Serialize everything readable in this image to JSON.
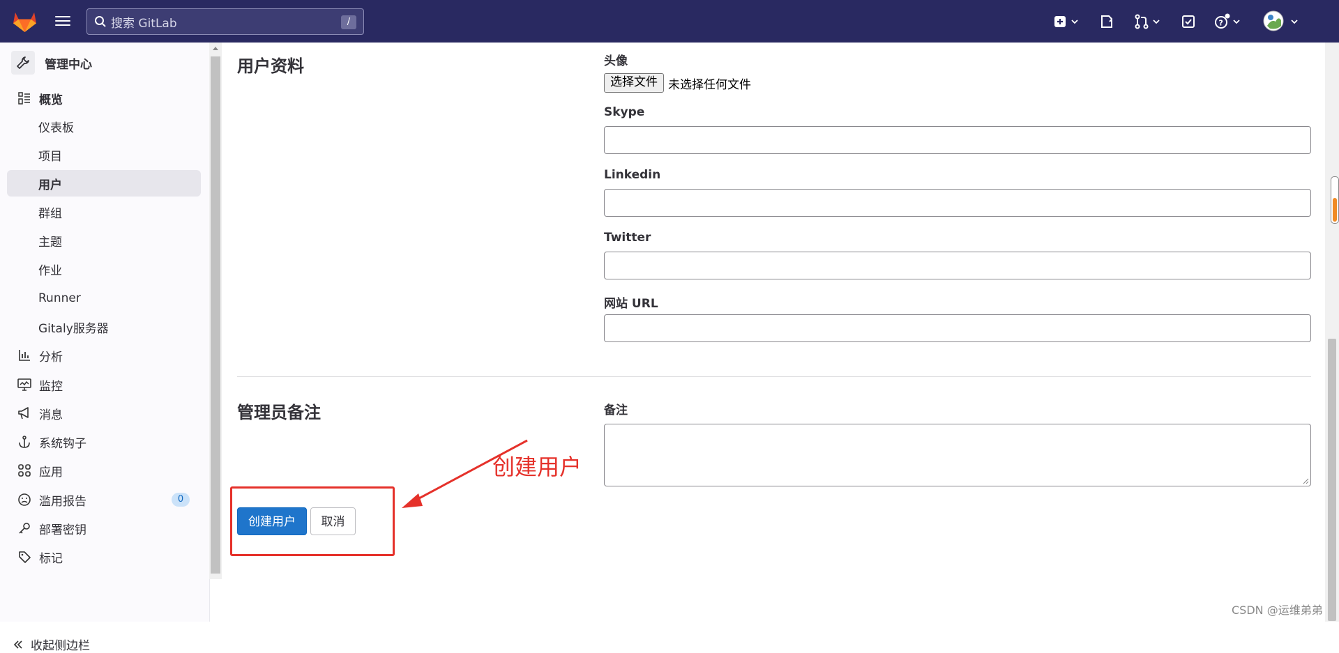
{
  "topbar": {
    "search_placeholder": "搜索 GitLab",
    "search_shortcut": "/"
  },
  "sidebar": {
    "header": "管理中心",
    "items": [
      {
        "label": "概览",
        "icon": "overview-icon"
      },
      {
        "label": "仪表板"
      },
      {
        "label": "项目"
      },
      {
        "label": "用户"
      },
      {
        "label": "群组"
      },
      {
        "label": "主题"
      },
      {
        "label": "作业"
      },
      {
        "label": "Runner"
      },
      {
        "label": "Gitaly服务器"
      },
      {
        "label": "分析",
        "icon": "chart-icon"
      },
      {
        "label": "监控",
        "icon": "monitor-icon"
      },
      {
        "label": "消息",
        "icon": "megaphone-icon"
      },
      {
        "label": "系统钩子",
        "icon": "anchor-icon"
      },
      {
        "label": "应用",
        "icon": "apps-icon"
      },
      {
        "label": "滥用报告",
        "icon": "smile-icon",
        "badge": "0"
      },
      {
        "label": "部署密钥",
        "icon": "key-icon"
      },
      {
        "label": "标记",
        "icon": "label-icon"
      }
    ],
    "collapse_label": "收起侧边栏"
  },
  "profile_section": {
    "title": "用户资料",
    "avatar_label": "头像",
    "file_button": "选择文件",
    "file_status": "未选择任何文件",
    "skype_label": "Skype",
    "linkedin_label": "Linkedin",
    "twitter_label": "Twitter",
    "website_label": "网站 URL"
  },
  "admin_section": {
    "title": "管理员备注",
    "note_label": "备注"
  },
  "actions": {
    "create_label": "创建用户",
    "cancel_label": "取消"
  },
  "annotation": {
    "text": "创建用户",
    "color": "#e5312a"
  },
  "watermark": "CSDN @运维弟弟",
  "colors": {
    "topbar": "#292961",
    "primary": "#1f75cb"
  }
}
